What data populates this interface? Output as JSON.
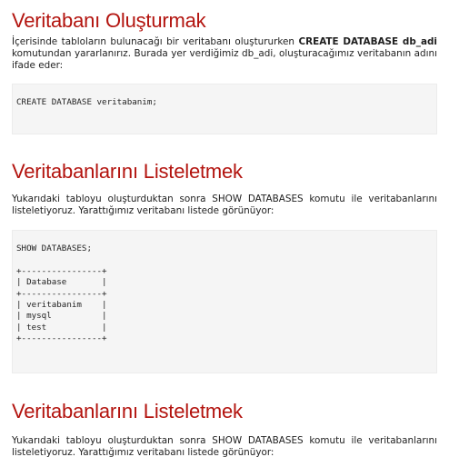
{
  "sections": [
    {
      "title": "Veritabanı Oluşturmak",
      "text_before": "İçerisinde tabloların bulunacağı bir veritabanı oluştururken ",
      "text_bold": "CREATE DATABASE db_adi",
      "text_after": " komutundan yararlanırız. Burada yer verdiğimiz db_adi, oluşturacağımız veritabanın adını ifade eder:",
      "code": "CREATE DATABASE veritabanim;"
    },
    {
      "title": "Veritabanlarını Listeletmek",
      "text": "Yukarıdaki tabloyu oluşturduktan sonra SHOW DATABASES komutu ile veritabanlarını listeletiyoruz. Yarattığımız veritabanı listede görünüyor:",
      "code": "SHOW DATABASES;\n\n+----------------+\n| Database       |\n+----------------+\n| veritabanim    |\n| mysql          |\n| test           |\n+----------------+"
    },
    {
      "title": "Veritabanlarını Listeletmek",
      "text": "Yukarıdaki tabloyu oluşturduktan sonra SHOW DATABASES komutu ile veritabanlarını listeletiyoruz. Yarattığımız veritabanı listede görünüyor:"
    }
  ]
}
